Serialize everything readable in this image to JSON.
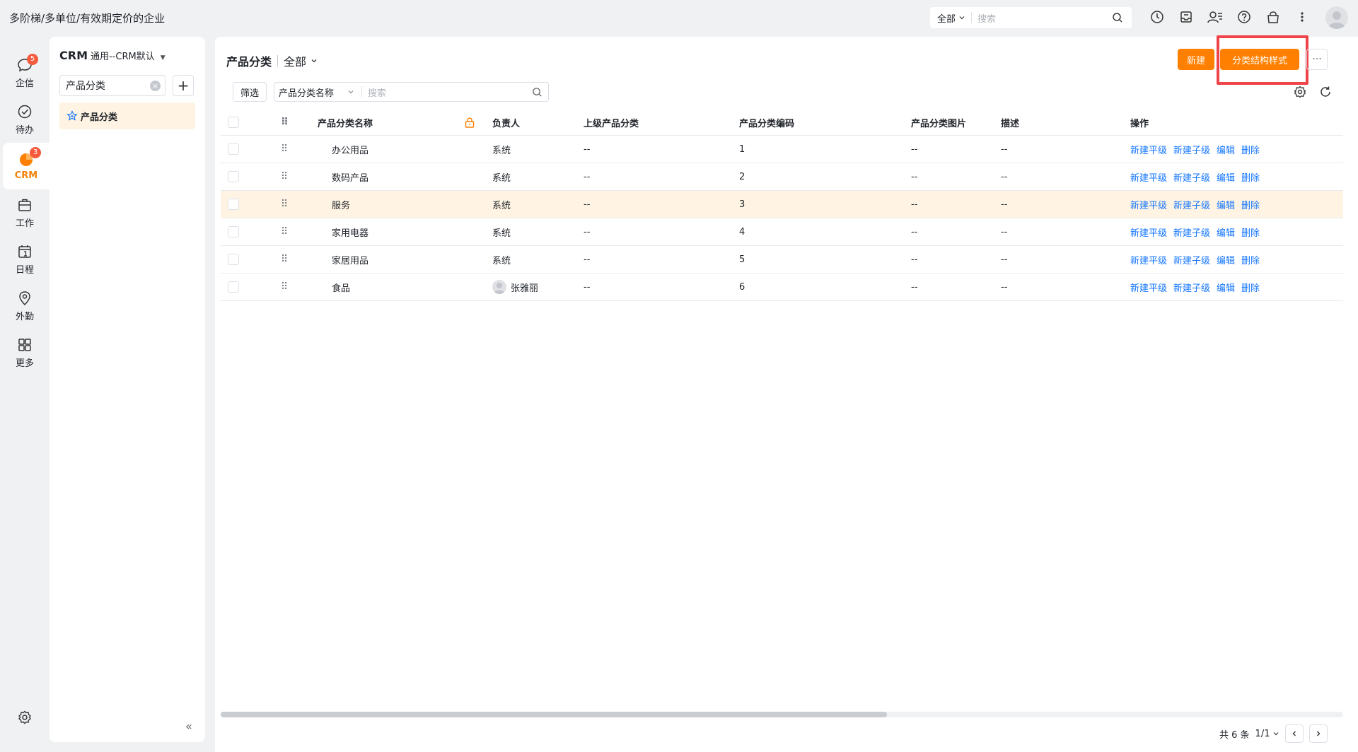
{
  "topbar": {
    "company": "多阶梯/多单位/有效期定价的企业",
    "search_scope": "全部",
    "search_placeholder": "搜索",
    "icons": [
      "clock-icon",
      "inbox-icon",
      "contacts-icon",
      "help-icon",
      "bag-icon",
      "more-vert-icon"
    ]
  },
  "rail": {
    "items": [
      {
        "label": "企信",
        "icon": "chat-icon",
        "badge": "5"
      },
      {
        "label": "待办",
        "icon": "check-circle-icon",
        "badge": ""
      },
      {
        "label": "CRM",
        "icon": "crm-icon",
        "badge": "3"
      },
      {
        "label": "工作",
        "icon": "briefcase-icon",
        "badge": ""
      },
      {
        "label": "日程",
        "icon": "calendar-icon",
        "badge": ""
      },
      {
        "label": "外勤",
        "icon": "location-icon",
        "badge": ""
      },
      {
        "label": "更多",
        "icon": "grid-icon",
        "badge": ""
      }
    ]
  },
  "sidebar": {
    "title": "CRM",
    "subtitle": "通用--CRM默认",
    "search_value": "产品分类",
    "active_item": "产品分类"
  },
  "main": {
    "title": "产品分类",
    "scope": "全部",
    "new_button": "新建",
    "structure_button": "分类结构样式",
    "more_button": "···",
    "filter_button": "筛选",
    "search_field": "产品分类名称",
    "search_placeholder": "搜索"
  },
  "table": {
    "columns": [
      "产品分类名称",
      "负责人",
      "上级产品分类",
      "产品分类编码",
      "产品分类图片",
      "描述",
      "操作"
    ],
    "rows": [
      {
        "name": "办公用品",
        "owner": "系统",
        "parent": "--",
        "code": "1",
        "image": "--",
        "desc": "--",
        "owner_avatar": false
      },
      {
        "name": "数码产品",
        "owner": "系统",
        "parent": "--",
        "code": "2",
        "image": "--",
        "desc": "--",
        "owner_avatar": false
      },
      {
        "name": "服务",
        "owner": "系统",
        "parent": "--",
        "code": "3",
        "image": "--",
        "desc": "--",
        "owner_avatar": false
      },
      {
        "name": "家用电器",
        "owner": "系统",
        "parent": "--",
        "code": "4",
        "image": "--",
        "desc": "--",
        "owner_avatar": false
      },
      {
        "name": "家居用品",
        "owner": "系统",
        "parent": "--",
        "code": "5",
        "image": "--",
        "desc": "--",
        "owner_avatar": false
      },
      {
        "name": "食品",
        "owner": "张雅丽",
        "parent": "--",
        "code": "6",
        "image": "--",
        "desc": "--",
        "owner_avatar": true
      }
    ],
    "actions": [
      "新建平级",
      "新建子级",
      "编辑",
      "删除"
    ]
  },
  "pager": {
    "total": "共 6 条",
    "page": "1/1"
  },
  "colors": {
    "accent": "#ff8000",
    "link": "#1677ff",
    "highlight": "#f0444b",
    "selected_bg": "#fff4e3"
  }
}
